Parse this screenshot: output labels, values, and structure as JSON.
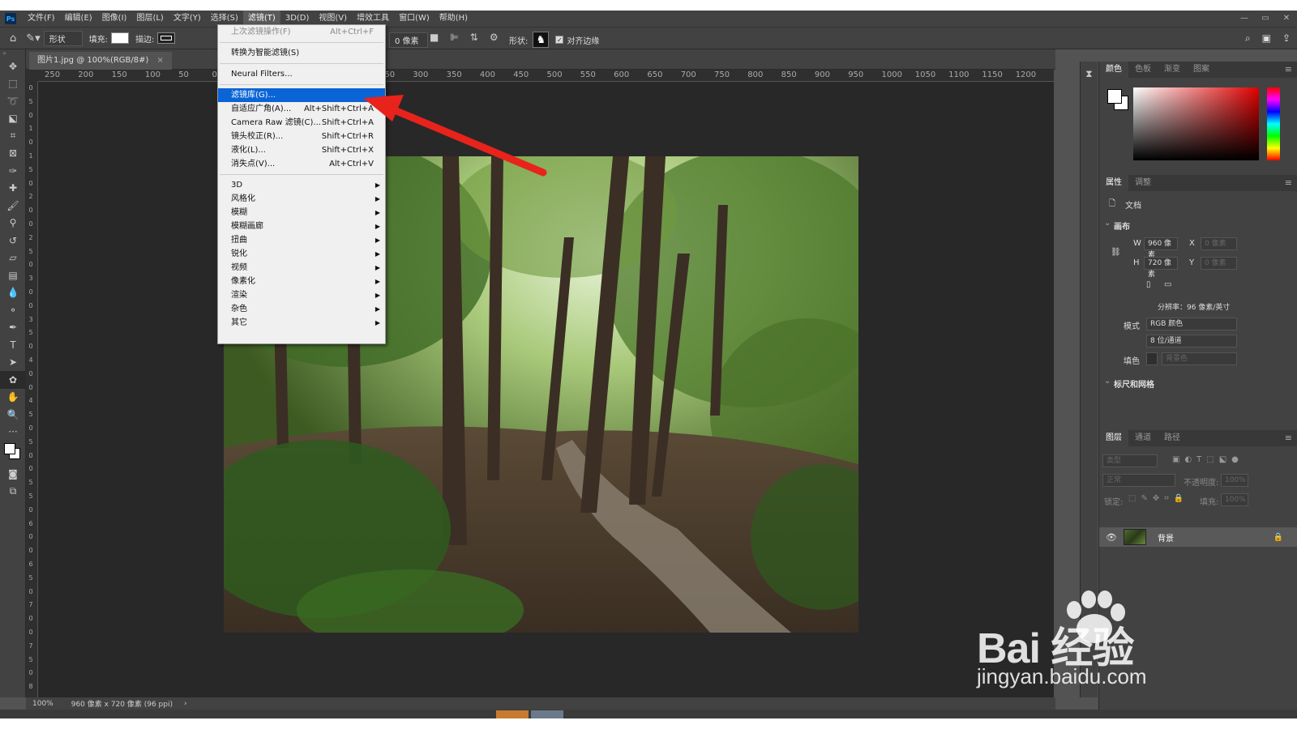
{
  "app": {
    "logo": "Ps"
  },
  "menubar": {
    "items": [
      "文件(F)",
      "编辑(E)",
      "图像(I)",
      "图层(L)",
      "文字(Y)",
      "选择(S)",
      "滤镜(T)",
      "3D(D)",
      "视图(V)",
      "增效工具",
      "窗口(W)",
      "帮助(H)"
    ],
    "active_index": 6,
    "window_controls": [
      "—",
      "▭",
      "✕"
    ]
  },
  "options": {
    "mode": "形状",
    "fill_label": "填充:",
    "stroke_label": "描边:",
    "stroke_width": "0 像素",
    "shape_label": "形状:",
    "align_edges_label": "对齐边缘",
    "align_edges_checked": true
  },
  "document": {
    "tab_title": "图片1.jpg @ 100%(RGB/8#)",
    "tab_close": "×"
  },
  "ruler": {
    "h_ticks": [
      "250",
      "200",
      "150",
      "100",
      "50",
      "0",
      "50",
      "100",
      "150",
      "200",
      "250",
      "300",
      "350",
      "400",
      "450",
      "500",
      "550",
      "600",
      "650",
      "700",
      "750",
      "800",
      "850",
      "900",
      "950",
      "1000",
      "1050",
      "1100",
      "1150",
      "1200"
    ],
    "v_ticks": [
      "0",
      "5",
      "0",
      "1",
      "0",
      "1",
      "5",
      "0",
      "2",
      "0",
      "0",
      "2",
      "5",
      "0",
      "3",
      "0",
      "0",
      "3",
      "5",
      "0",
      "4",
      "0",
      "0",
      "4",
      "5",
      "0",
      "5",
      "0",
      "0",
      "5",
      "5",
      "0",
      "6",
      "0",
      "0",
      "6",
      "5",
      "0",
      "7",
      "0",
      "0",
      "7",
      "5",
      "0",
      "8"
    ]
  },
  "filter_menu": {
    "items": [
      {
        "label": "上次滤镜操作(F)",
        "shortcut": "Alt+Ctrl+F",
        "disabled": true
      },
      {
        "sep": true
      },
      {
        "label": "转换为智能滤镜(S)",
        "shortcut": ""
      },
      {
        "sep": true
      },
      {
        "label": "Neural Filters...",
        "shortcut": ""
      },
      {
        "sep": true
      },
      {
        "label": "滤镜库(G)...",
        "shortcut": "",
        "highlighted": true
      },
      {
        "label": "自适应广角(A)...",
        "shortcut": "Alt+Shift+Ctrl+A"
      },
      {
        "label": "Camera Raw 滤镜(C)...",
        "shortcut": "Shift+Ctrl+A"
      },
      {
        "label": "镜头校正(R)...",
        "shortcut": "Shift+Ctrl+R"
      },
      {
        "label": "液化(L)...",
        "shortcut": "Shift+Ctrl+X"
      },
      {
        "label": "消失点(V)...",
        "shortcut": "Alt+Ctrl+V"
      },
      {
        "sep": true
      },
      {
        "label": "3D",
        "submenu": true
      },
      {
        "label": "风格化",
        "submenu": true
      },
      {
        "label": "模糊",
        "submenu": true
      },
      {
        "label": "模糊画廊",
        "submenu": true
      },
      {
        "label": "扭曲",
        "submenu": true
      },
      {
        "label": "锐化",
        "submenu": true
      },
      {
        "label": "视频",
        "submenu": true
      },
      {
        "label": "像素化",
        "submenu": true
      },
      {
        "label": "渲染",
        "submenu": true
      },
      {
        "label": "杂色",
        "submenu": true
      },
      {
        "label": "其它",
        "submenu": true
      }
    ]
  },
  "status": {
    "zoom": "100%",
    "doc_info": "960 像素 x 720 像素 (96 ppi)",
    "more": "›"
  },
  "color_panel": {
    "tabs": [
      "颜色",
      "色板",
      "渐变",
      "图案"
    ],
    "active": 0,
    "menu": "≡"
  },
  "properties_panel": {
    "tabs": [
      "属性",
      "调整"
    ],
    "active": 0,
    "doc_label": "文档",
    "canvas_section": "画布",
    "w_label": "W",
    "w_value": "960 像素",
    "h_label": "H",
    "h_value": "720 像素",
    "x_label": "X",
    "x_value": "0 像素",
    "y_label": "Y",
    "y_value": "0 像素",
    "resolution": "分辨率：96 像素/英寸",
    "mode_label": "模式",
    "mode_value": "RGB 颜色",
    "depth_value": "8 位/通道",
    "fill_label": "填色",
    "fill_value": "背景色",
    "rulers_section": "标尺和网格",
    "menu": "≡"
  },
  "layers_panel": {
    "tabs": [
      "图层",
      "通道",
      "路径"
    ],
    "active": 0,
    "search_placeholder": "类型",
    "blend_mode": "正常",
    "opacity_label": "不透明度:",
    "opacity_value": "100%",
    "lock_label": "锁定:",
    "fill_label": "填充:",
    "fill_value": "100%",
    "layer_name": "背景",
    "footer_icons": [
      "∞",
      "fx",
      "▢",
      "◐",
      "▭",
      "+",
      "🗑"
    ],
    "menu": "≡"
  },
  "watermark": {
    "main": "Bai 经验",
    "url": "jingyan.baidu.com"
  },
  "colors": {
    "arrow": "#e8231c",
    "highlight": "#0a64d6"
  }
}
